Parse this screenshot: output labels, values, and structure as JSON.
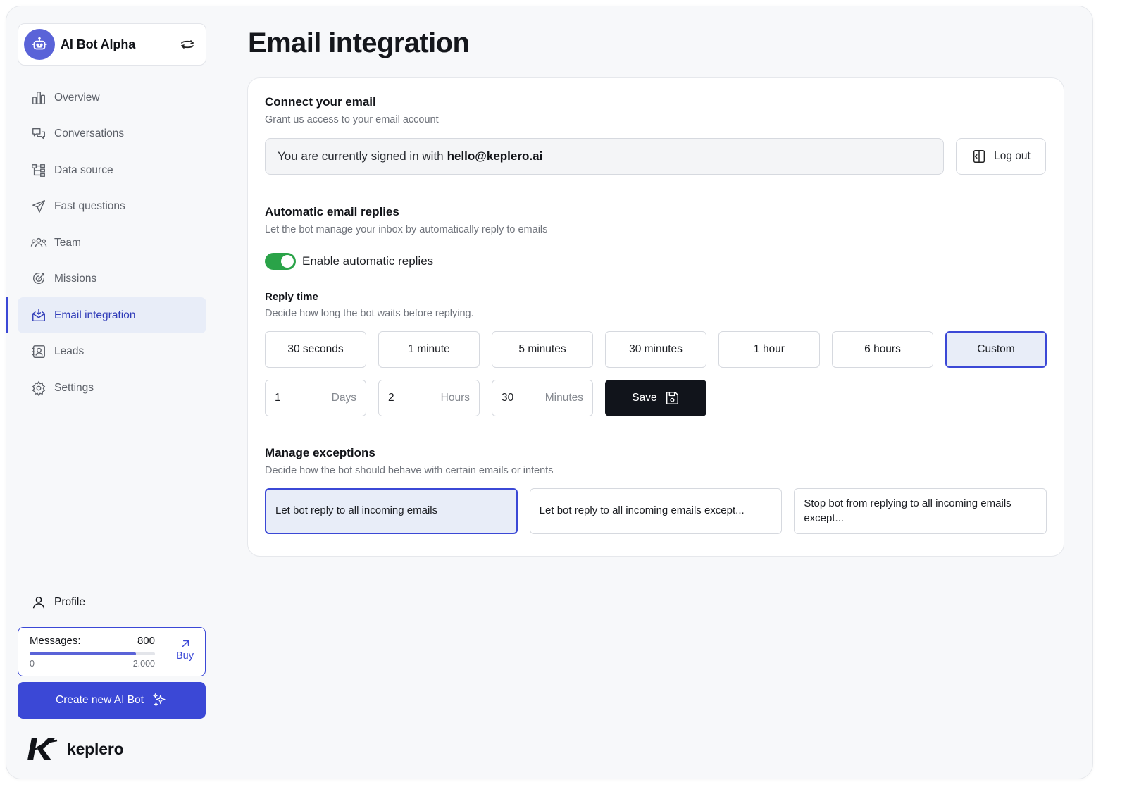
{
  "bot": {
    "name": "AI Bot Alpha"
  },
  "nav": {
    "items": [
      {
        "label": "Overview",
        "icon": "chart-bar-icon"
      },
      {
        "label": "Conversations",
        "icon": "chat-bubbles-icon"
      },
      {
        "label": "Data source",
        "icon": "hierarchy-icon"
      },
      {
        "label": "Fast questions",
        "icon": "paper-plane-icon"
      },
      {
        "label": "Team",
        "icon": "team-icon"
      },
      {
        "label": "Missions",
        "icon": "target-icon"
      },
      {
        "label": "Email integration",
        "icon": "mail-icon",
        "active": true
      },
      {
        "label": "Leads",
        "icon": "contact-card-icon"
      },
      {
        "label": "Settings",
        "icon": "gear-icon"
      }
    ],
    "profile": "Profile"
  },
  "usage": {
    "label": "Messages:",
    "current": "800",
    "min": "0",
    "max": "2.000",
    "fraction": 0.85,
    "buy": "Buy"
  },
  "create_button": "Create new AI Bot",
  "brand": "keplero",
  "page": {
    "title": "Email integration"
  },
  "connect": {
    "title": "Connect your email",
    "subtitle": "Grant us access to your email account",
    "signed_prefix": "You are currently signed in with",
    "email": "hello@keplero.ai",
    "logout": "Log out"
  },
  "auto": {
    "title": "Automatic email replies",
    "subtitle": "Let the bot manage your inbox by automatically reply to emails",
    "toggle_label": "Enable automatic replies",
    "enabled": true
  },
  "reply_time": {
    "title": "Reply time",
    "subtitle": "Decide how long the bot waits before replying.",
    "options": [
      "30 seconds",
      "1 minute",
      "5 minutes",
      "30 minutes",
      "1 hour",
      "6 hours",
      "Custom"
    ],
    "selected": "Custom",
    "custom": [
      {
        "value": "1",
        "unit": "Days"
      },
      {
        "value": "2",
        "unit": "Hours"
      },
      {
        "value": "30",
        "unit": "Minutes"
      }
    ],
    "save": "Save"
  },
  "exceptions": {
    "title": "Manage exceptions",
    "subtitle": "Decide how the bot should behave with certain emails or intents",
    "options": [
      "Let bot reply to all incoming emails",
      "Let bot reply to all incoming emails except...",
      "Stop bot from replying to all incoming emails except..."
    ],
    "selected_index": 0
  },
  "colors": {
    "accent": "#3b48d6",
    "active_bg": "#e8edf8",
    "toggle_on": "#2aa348",
    "dark_button": "#11141b"
  }
}
